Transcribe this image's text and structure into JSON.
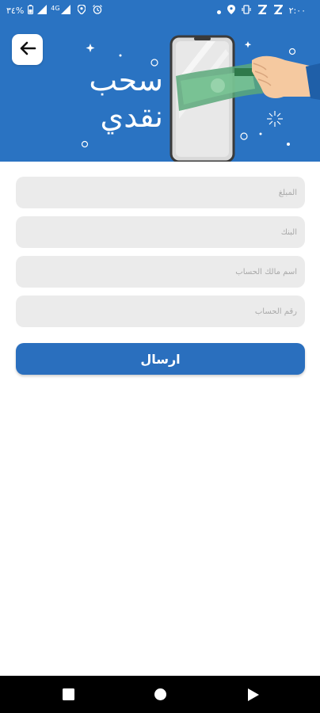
{
  "status_bar": {
    "time": "٢:٠٠",
    "battery_percent": "٣٤%",
    "network_label": "4G",
    "colors": {
      "background": "#2a73c2",
      "foreground": "#ffffff"
    },
    "icons": [
      "battery-icon",
      "signal-icon",
      "signal-4g-icon",
      "location-icon",
      "alarm-icon",
      "dot-icon",
      "location-icon",
      "vibrate-icon",
      "sleep-icon",
      "sleep-icon"
    ]
  },
  "header": {
    "title_line1": "سحب",
    "title_line2": "نقدي",
    "back_icon": "arrow-left-icon",
    "illustration": "phone-with-cash-illustration",
    "background_color": "#2a73c2"
  },
  "form": {
    "amount_placeholder": "المبلغ",
    "bank_placeholder": "البنك",
    "account_holder_placeholder": "اسم مالك الحساب",
    "account_number_placeholder": "رقم الحساب",
    "submit_label": "ارسال",
    "colors": {
      "field_bg": "#ebebeb",
      "button_bg": "#2a6fbe"
    }
  },
  "nav_bar": {
    "icons": [
      "recents-square-icon",
      "home-circle-icon",
      "back-triangle-icon"
    ]
  }
}
